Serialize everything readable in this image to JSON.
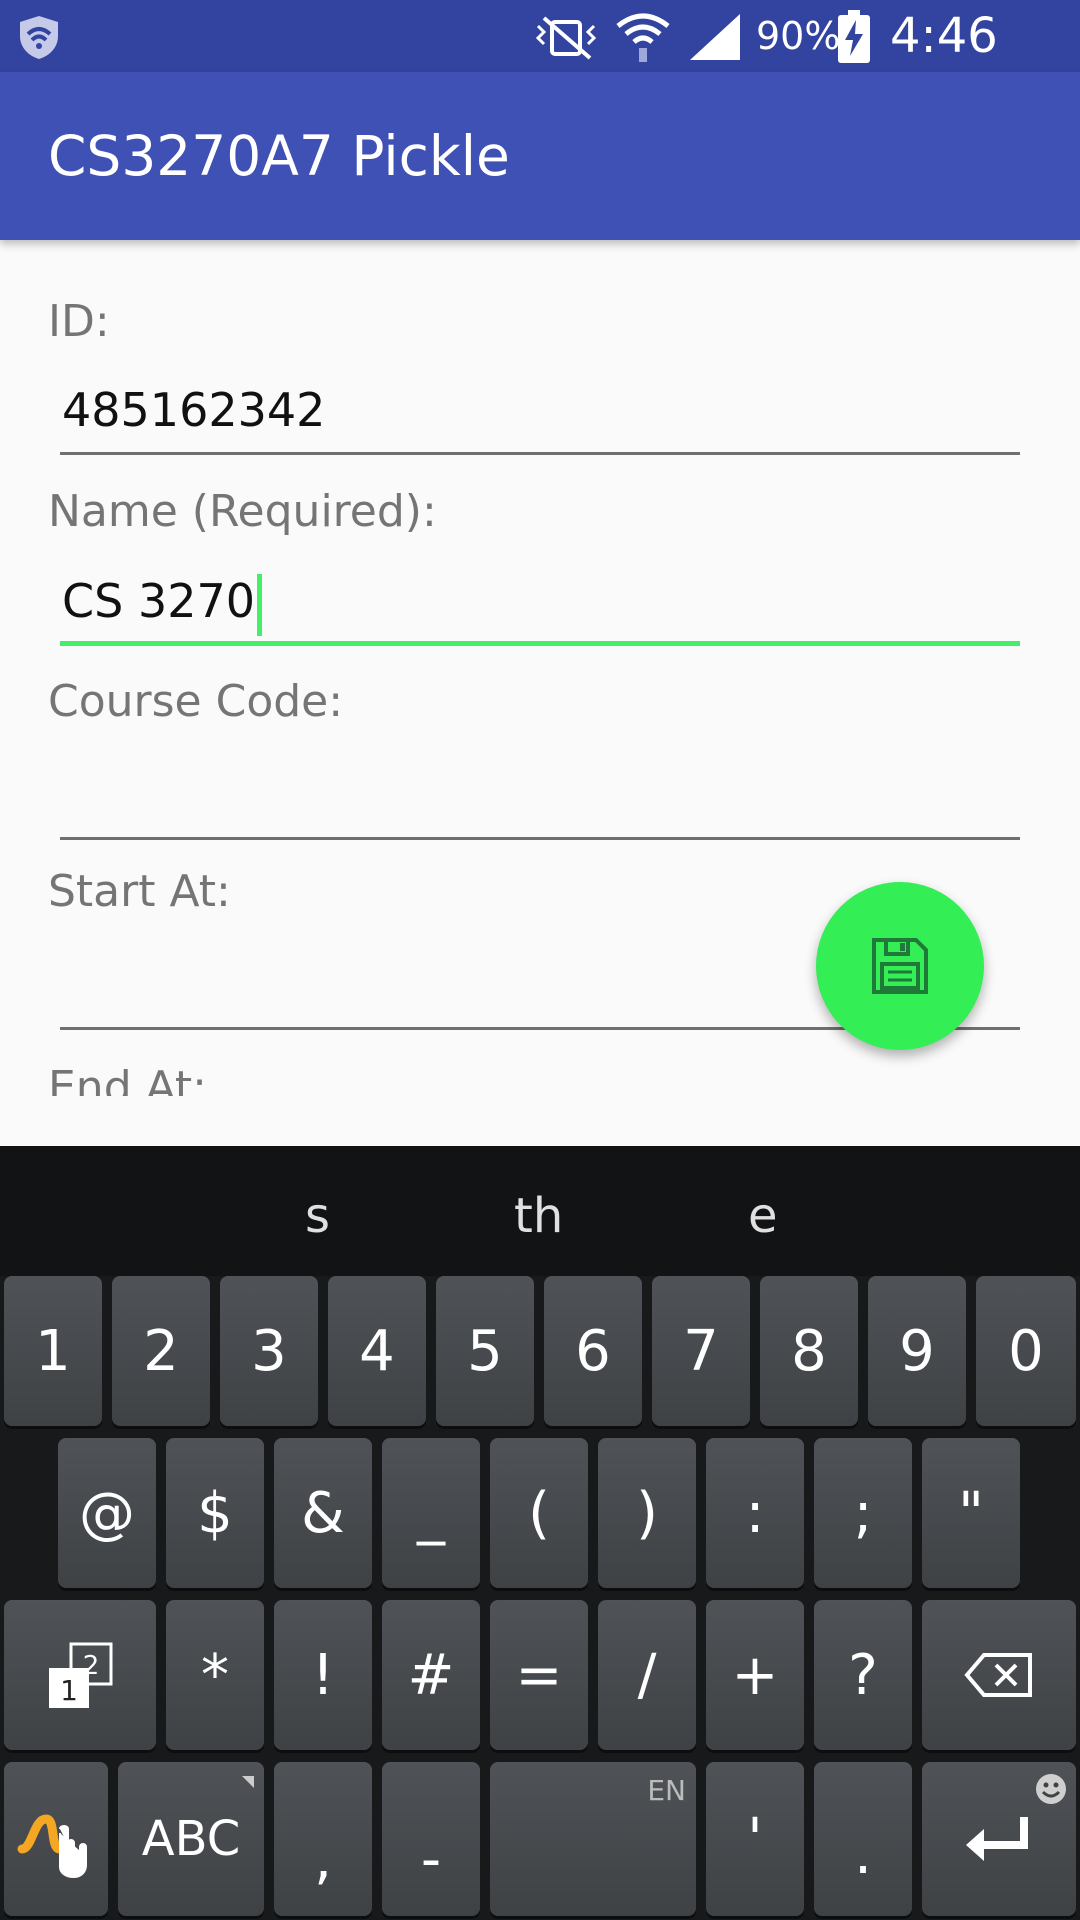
{
  "status_bar": {
    "battery": "90%",
    "time": "4:46 PM"
  },
  "app_bar": {
    "title": "CS3270A7 Pickle"
  },
  "form": {
    "id_label": "ID:",
    "id_value": "485162342",
    "name_label": "Name (Required):",
    "name_value": "CS 3270",
    "course_label": "Course Code:",
    "course_value": "",
    "start_label": "Start At:",
    "start_value": "",
    "end_label": "End At:"
  },
  "fab": {
    "icon": "save-icon",
    "color": "#33ee55"
  },
  "keyboard": {
    "suggestions": [
      "s",
      "th",
      "e"
    ],
    "row1": [
      "1",
      "2",
      "3",
      "4",
      "5",
      "6",
      "7",
      "8",
      "9",
      "0"
    ],
    "row2": [
      "@",
      "$",
      "&",
      "_",
      "(",
      ")",
      ":",
      ";",
      "\""
    ],
    "row3": [
      "*",
      "!",
      "#",
      "=",
      "/",
      "+",
      "?"
    ],
    "abc_label": "ABC",
    "comma": ",",
    "dash": "-",
    "lang": "EN",
    "apostrophe": "'",
    "period": "."
  },
  "colors": {
    "app_bar": "#3f51b5",
    "status_bar": "#3344a0",
    "accent": "#44ee66"
  }
}
